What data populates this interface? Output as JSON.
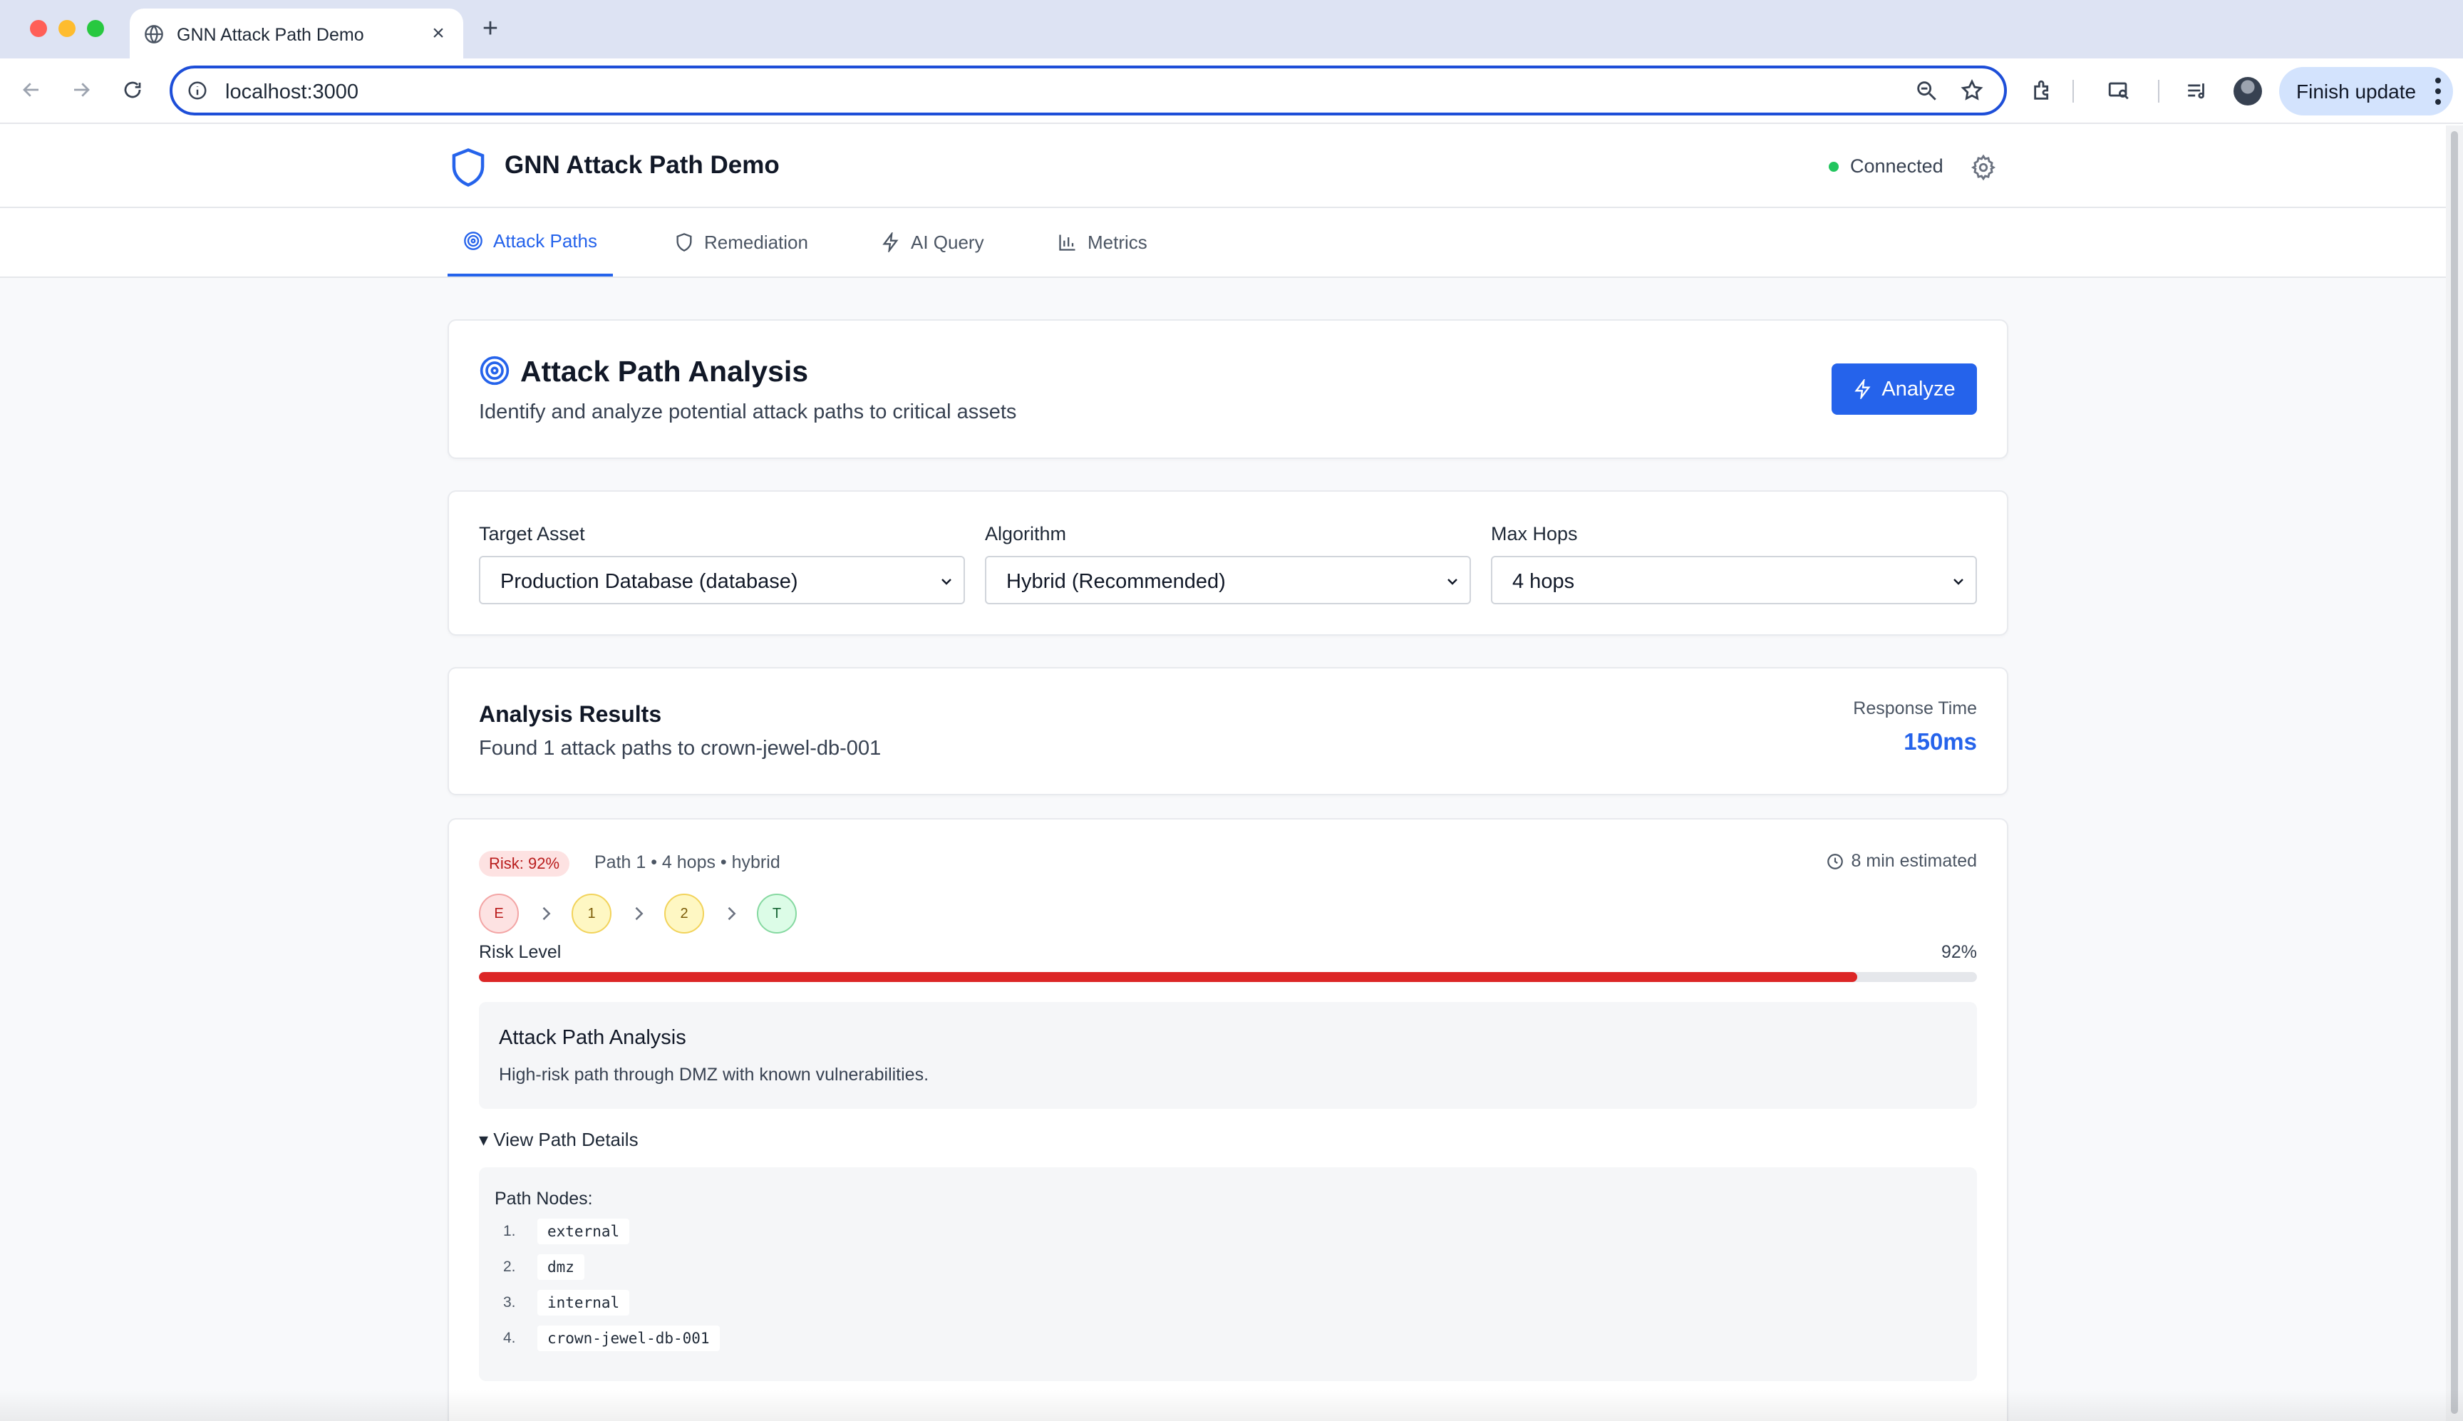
{
  "browser": {
    "tab_title": "GNN Attack Path Demo",
    "url": "localhost:3000",
    "update_label": "Finish update"
  },
  "app": {
    "title": "GNN Attack Path Demo",
    "status": "Connected",
    "status_color": "#22c55e",
    "accent": "#2563eb",
    "tabs": [
      {
        "label": "Attack Paths",
        "icon": "target-icon",
        "active": true
      },
      {
        "label": "Remediation",
        "icon": "shield-icon",
        "active": false
      },
      {
        "label": "AI Query",
        "icon": "zap-icon",
        "active": false
      },
      {
        "label": "Metrics",
        "icon": "bar-chart-icon",
        "active": false
      }
    ]
  },
  "analysis": {
    "title": "Attack Path Analysis",
    "subtitle": "Identify and analyze potential attack paths to critical assets",
    "button_label": "Analyze"
  },
  "config": {
    "target_label": "Target Asset",
    "target_value": "Production Database (database)",
    "algorithm_label": "Algorithm",
    "algorithm_value": "Hybrid (Recommended)",
    "hops_label": "Max Hops",
    "hops_value": "4 hops"
  },
  "results": {
    "title": "Analysis Results",
    "summary": "Found 1 attack paths to crown-jewel-db-001",
    "response_label": "Response Time",
    "response_value": "150ms"
  },
  "path": {
    "risk_badge": "Risk: 92%",
    "meta": "Path 1 • 4 hops • hybrid",
    "estimate": "8 min estimated",
    "nodes": [
      "E",
      "1",
      "2",
      "T"
    ],
    "risk_label": "Risk Level",
    "risk_value": "92%",
    "risk_fraction": 0.92,
    "risk_color": "#dc2626",
    "analysis_title": "Attack Path Analysis",
    "analysis_text": "High-risk path through DMZ with known vulnerabilities.",
    "details_label": "▾ View Path Details",
    "nodes_label": "Path Nodes:",
    "node_list": [
      {
        "num": "1.",
        "name": "external"
      },
      {
        "num": "2.",
        "name": "dmz"
      },
      {
        "num": "3.",
        "name": "internal"
      },
      {
        "num": "4.",
        "name": "crown-jewel-db-001"
      }
    ]
  }
}
